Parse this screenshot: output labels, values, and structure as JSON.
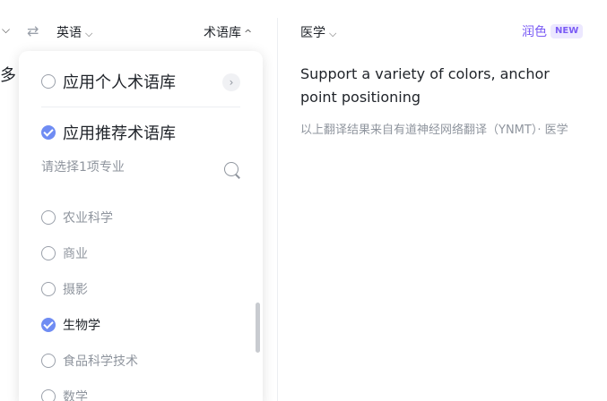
{
  "topbar": {
    "source_language": "英语",
    "term_library": "术语库",
    "domain": "医学",
    "polish": "润色",
    "new_badge": "NEW"
  },
  "cut_text": "多",
  "translation": {
    "text": "Support a variety of colors, anchor point positioning",
    "source_note": "以上翻译结果来自有道神经网络翻译（YNMT）· 医学"
  },
  "dropdown": {
    "personal_option": "应用个人术语库",
    "recommended_option": "应用推荐术语库",
    "search_placeholder": "请选择1项专业",
    "items": [
      {
        "label": "农业科学",
        "checked": false
      },
      {
        "label": "商业",
        "checked": false
      },
      {
        "label": "摄影",
        "checked": false
      },
      {
        "label": "生物学",
        "checked": true
      },
      {
        "label": "食品科学技术",
        "checked": false
      },
      {
        "label": "数学",
        "checked": false
      }
    ]
  },
  "colors": {
    "accent": "#6f8cf3",
    "polish": "#7b5cf5",
    "muted_text": "#8f959e"
  },
  "icons": [
    "chevron-down-icon",
    "swap-icon",
    "chevron-up-icon",
    "chevron-right-icon",
    "search-icon",
    "check-icon"
  ]
}
